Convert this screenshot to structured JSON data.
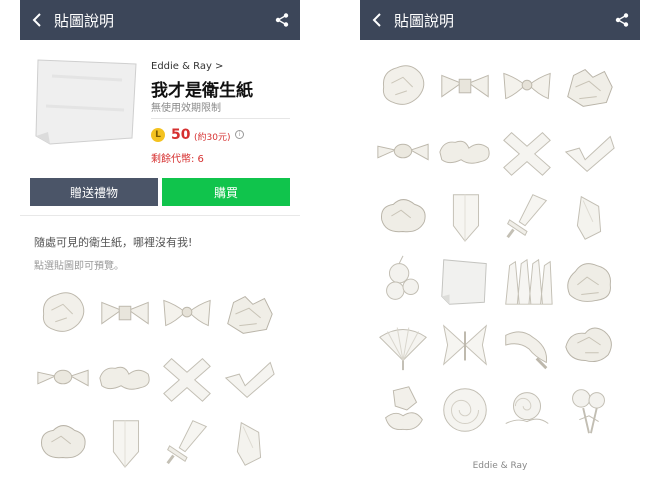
{
  "header": {
    "title": "貼圖說明"
  },
  "left": {
    "author": "Eddie & Ray >",
    "pack_name": "我才是衛生紙",
    "validity": "無使用效期限制",
    "coin_symbol": "L",
    "price": "50",
    "price_twd": "(約30元)",
    "info_symbol": "i",
    "remaining": "剩餘代幣: 6",
    "gift_button": "贈送禮物",
    "buy_button": "購買",
    "description": "隨處可見的衛生紙，哪裡沒有我!",
    "hint": "點選貼圖即可預覽。"
  },
  "right": {
    "credit": "Eddie & Ray"
  },
  "colors": {
    "topbar": "#3c4659",
    "buy": "#10c44c",
    "gift": "#4b5568",
    "price": "#d63030",
    "coin": "#f4c21f"
  },
  "icons": {
    "back": "chevron-left-icon",
    "share": "share-icon"
  },
  "stickers_left": [
    "crumpled-ball",
    "twist",
    "bow",
    "crumpled-pile",
    "small-bow",
    "double-crumple",
    "cross",
    "checkmark",
    "crumple",
    "folded-point",
    "sword",
    "scroll"
  ],
  "stickers_right": [
    "crumpled-ball",
    "twist",
    "bow",
    "crumpled-pile",
    "small-bow",
    "double-crumple",
    "cross",
    "checkmark",
    "crumple",
    "folded-point",
    "sword",
    "scroll",
    "pompom",
    "paper-sheet",
    "tubes",
    "crumple-pile",
    "fan",
    "butterfly",
    "swirl",
    "flower-crumple",
    "rose-bud",
    "rose",
    "rosette",
    "bouquet"
  ]
}
